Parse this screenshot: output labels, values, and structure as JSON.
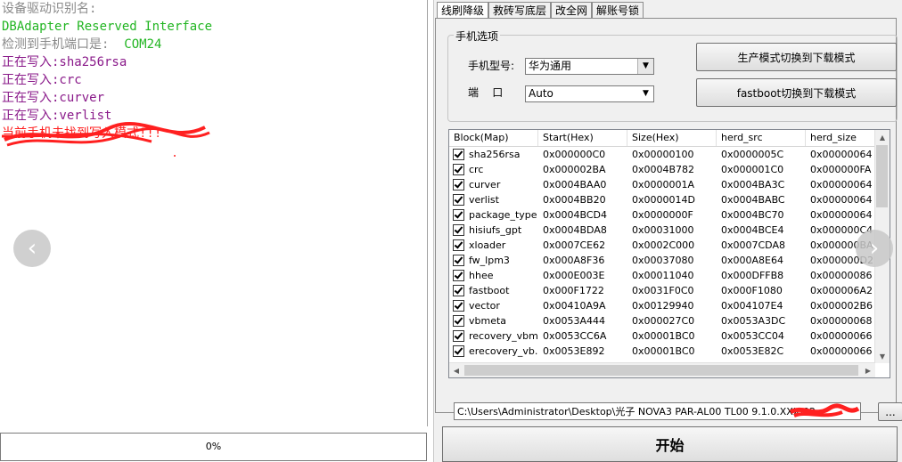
{
  "log": {
    "lines": [
      {
        "text": "设备驱动识别名:",
        "color": "gray"
      },
      {
        "text": "DBAdapter Reserved Interface",
        "color": "green"
      },
      {
        "text": "检测到手机端口是:  COM24",
        "color": "gray_green"
      },
      {
        "text": "正在写入:sha256rsa",
        "color": "purple"
      },
      {
        "text": "正在写入:crc",
        "color": "purple"
      },
      {
        "text": "正在写入:curver",
        "color": "purple"
      },
      {
        "text": "正在写入:verlist",
        "color": "purple"
      },
      {
        "text": "当前手机未找到写入模式!!!",
        "color": "red"
      }
    ],
    "port_prefix": "检测到手机端口是:",
    "port_value": "COM24"
  },
  "progress": {
    "text": "0%",
    "value": 0
  },
  "tabs": [
    "线刷降级",
    "救砖写底层",
    "改全网",
    "解账号锁"
  ],
  "phone_options": {
    "title": "手机选项",
    "model_label": "手机型号:",
    "model_value": "华为通用",
    "port_label": "端    口",
    "port_value": "Auto",
    "btn_prod_to_dl": "生产模式切换到下载模式",
    "btn_fastboot_to_dl": "fastboot切换到下载模式"
  },
  "table": {
    "columns": [
      "Block(Map)",
      "Start(Hex)",
      "Size(Hex)",
      "herd_src",
      "herd_size"
    ],
    "rows": [
      [
        "sha256rsa",
        "0x000000C0",
        "0x00000100",
        "0x0000005C",
        "0x00000064"
      ],
      [
        "crc",
        "0x000002BA",
        "0x0004B782",
        "0x000001C0",
        "0x000000FA"
      ],
      [
        "curver",
        "0x0004BAA0",
        "0x0000001A",
        "0x0004BA3C",
        "0x00000064"
      ],
      [
        "verlist",
        "0x0004BB20",
        "0x0000014D",
        "0x0004BABC",
        "0x00000064"
      ],
      [
        "package_type",
        "0x0004BCD4",
        "0x0000000F",
        "0x0004BC70",
        "0x00000064"
      ],
      [
        "hisiufs_gpt",
        "0x0004BDA8",
        "0x00031000",
        "0x0004BCE4",
        "0x000000C4"
      ],
      [
        "xloader",
        "0x0007CE62",
        "0x0002C000",
        "0x0007CDA8",
        "0x000000BA"
      ],
      [
        "fw_lpm3",
        "0x000A8F36",
        "0x00037080",
        "0x000A8E64",
        "0x000000D2"
      ],
      [
        "hhee",
        "0x000E003E",
        "0x00011040",
        "0x000DFFB8",
        "0x00000086"
      ],
      [
        "fastboot",
        "0x000F1722",
        "0x0031F0C0",
        "0x000F1080",
        "0x000006A2"
      ],
      [
        "vector",
        "0x00410A9A",
        "0x00129940",
        "0x004107E4",
        "0x000002B6"
      ],
      [
        "vbmeta",
        "0x0053A444",
        "0x000027C0",
        "0x0053A3DC",
        "0x00000068"
      ],
      [
        "recovery_vbm...",
        "0x0053CC6A",
        "0x00001BC0",
        "0x0053CC04",
        "0x00000066"
      ],
      [
        "erecovery_vb...",
        "0x0053E892",
        "0x00001BC0",
        "0x0053E82C",
        "0x00000066"
      ]
    ]
  },
  "path": {
    "value": "C:\\Users\\Administrator\\Desktop\\光子 NOVA3 PAR-AL00 TL00 9.1.0.XXX\\02"
  },
  "browse_label": "...",
  "start_label": "开始",
  "colors": {
    "gray": "#8a8a8a",
    "green": "#22b522",
    "purple": "#8a1a8a",
    "red": "#ff2020",
    "accent": "#3399ff"
  }
}
